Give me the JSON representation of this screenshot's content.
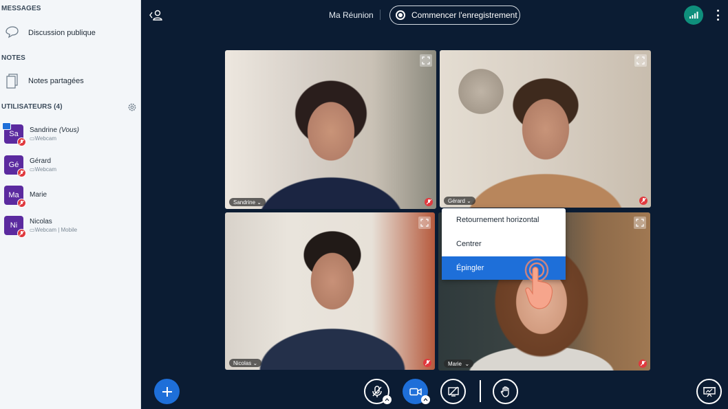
{
  "sidebar": {
    "messages_title": "MESSAGES",
    "public_chat_label": "Discussion publique",
    "notes_title": "NOTES",
    "shared_notes_label": "Notes partagées",
    "users_title": "UTILISATEURS (4)",
    "users": [
      {
        "initials": "Sa",
        "name": "Sandrine",
        "suffix": "(Vous)",
        "sub": "Webcam"
      },
      {
        "initials": "Gé",
        "name": "Gérard",
        "suffix": "",
        "sub": "Webcam"
      },
      {
        "initials": "Ma",
        "name": "Marie",
        "suffix": "",
        "sub": ""
      },
      {
        "initials": "Ni",
        "name": "Nicolas",
        "suffix": "",
        "sub": "Webcam | Mobile"
      }
    ]
  },
  "header": {
    "meeting_title": "Ma Réunion",
    "record_label": "Commencer l'enregistrement"
  },
  "tiles": [
    {
      "name": "Sandrine"
    },
    {
      "name": "Gérard"
    },
    {
      "name": "Nicolas"
    },
    {
      "name": "Marie"
    }
  ],
  "menu": {
    "items": [
      "Retournement horizontal",
      "Centrer",
      "Épingler"
    ]
  },
  "colors": {
    "background": "#0b1c33",
    "accent": "#1e6fd9",
    "avatar": "#5b2a9f",
    "muted": "#e0393e",
    "connection": "#0f8f7c"
  }
}
